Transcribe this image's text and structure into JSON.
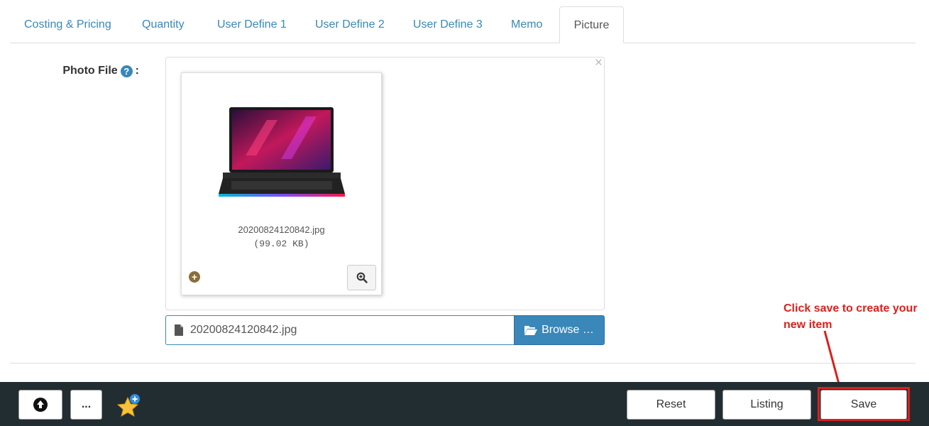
{
  "tabs": [
    {
      "label": "Costing & Pricing",
      "active": false
    },
    {
      "label": "Quantity",
      "active": false
    },
    {
      "label": "User Define 1",
      "active": false
    },
    {
      "label": "User Define 2",
      "active": false
    },
    {
      "label": "User Define 3",
      "active": false
    },
    {
      "label": "Memo",
      "active": false
    },
    {
      "label": "Picture",
      "active": true
    }
  ],
  "photo": {
    "label": "Photo File",
    "label_suffix": ":",
    "help_glyph": "?",
    "close_glyph": "×",
    "preview": {
      "file_name": "20200824120842.jpg",
      "file_size": "(99.02 KB)"
    },
    "selected_file": "20200824120842.jpg",
    "browse_label": "Browse …"
  },
  "annotation": {
    "text": "Click save to create your new item",
    "color": "#d9211d"
  },
  "footer": {
    "more_label": "...",
    "reset_label": "Reset",
    "listing_label": "Listing",
    "save_label": "Save"
  },
  "colors": {
    "accent": "#3a87b9",
    "footer_bg": "#222d32",
    "highlight": "#d9211d"
  }
}
